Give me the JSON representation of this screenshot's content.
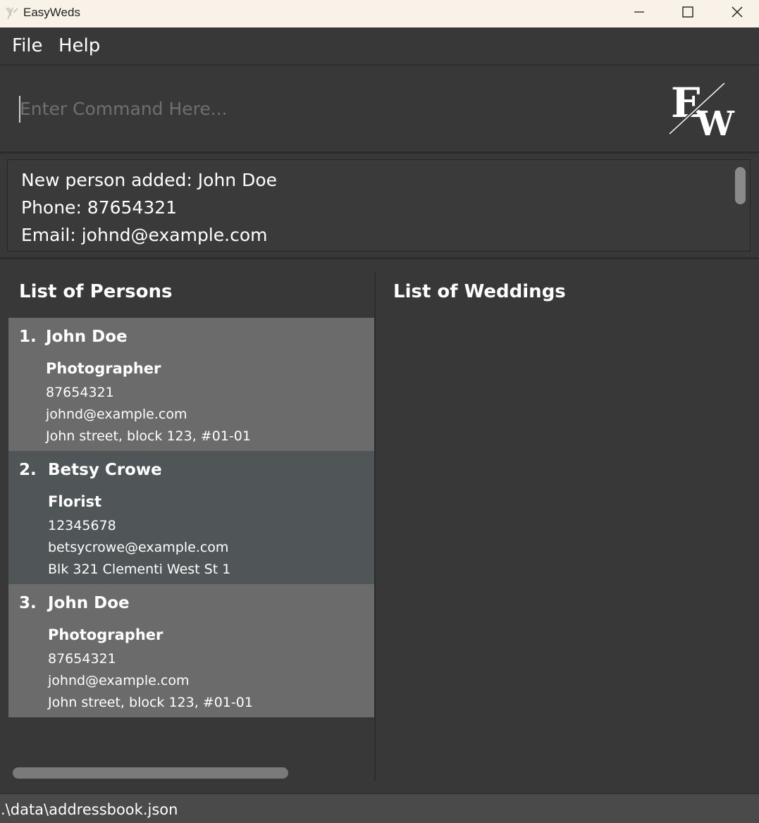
{
  "window": {
    "title": "EasyWeds",
    "icon": "easyweds-app-icon"
  },
  "menu": {
    "file": "File",
    "help": "Help"
  },
  "command": {
    "placeholder": "Enter Command Here...",
    "value": ""
  },
  "logo": {
    "text_e": "E",
    "text_w": "W"
  },
  "result": {
    "lines": [
      "New person added: John Doe",
      "Phone: 87654321",
      "Email: johnd@example.com"
    ]
  },
  "persons_panel": {
    "title": "List of Persons",
    "persons": [
      {
        "index": "1.",
        "name": "John Doe",
        "role": "Photographer",
        "phone": "87654321",
        "email": "johnd@example.com",
        "address": "John street, block 123, #01-01"
      },
      {
        "index": "2.",
        "name": "Betsy Crowe",
        "role": "Florist",
        "phone": "12345678",
        "email": "betsycrowe@example.com",
        "address": "Blk 321 Clementi West St 1"
      },
      {
        "index": "3.",
        "name": "John Doe",
        "role": "Photographer",
        "phone": "87654321",
        "email": "johnd@example.com",
        "address": "John street, block 123, #01-01"
      }
    ]
  },
  "weddings_panel": {
    "title": "List of Weddings"
  },
  "status": {
    "path": ".\\data\\addressbook.json"
  },
  "colors": {
    "background": "#383838",
    "card_odd": "#6b6b6b",
    "card_even": "#505558",
    "titlebar": "#f9f2e8"
  }
}
